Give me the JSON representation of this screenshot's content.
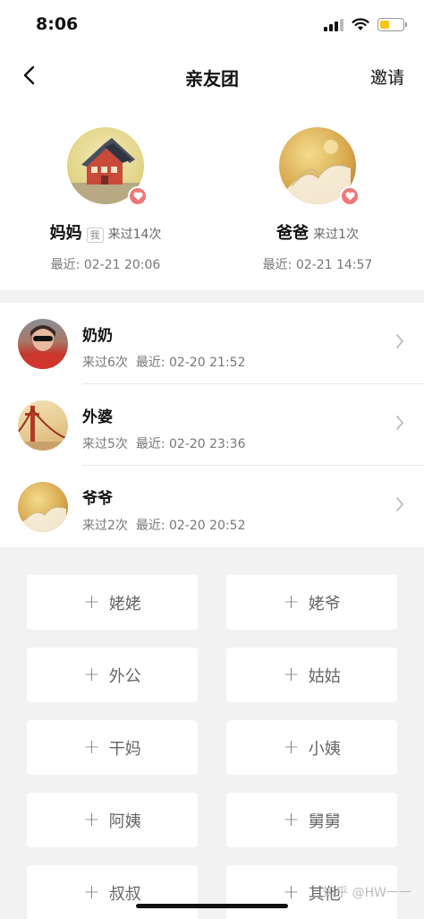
{
  "status": {
    "time": "8:06"
  },
  "nav": {
    "title": "亲友团",
    "invite_label": "邀请"
  },
  "featured": [
    {
      "name": "妈妈",
      "tag": "我",
      "count": "来过14次",
      "recent": "最近: 02-21 20:06",
      "avatar": "house-avatar"
    },
    {
      "name": "爸爸",
      "tag": "",
      "count": "来过1次",
      "recent": "最近: 02-21 14:57",
      "avatar": "book-avatar"
    }
  ],
  "members": [
    {
      "name": "奶奶",
      "count": "来过6次",
      "recent": "最近: 02-20 21:52"
    },
    {
      "name": "外婆",
      "count": "来过5次",
      "recent": "最近: 02-20 23:36"
    },
    {
      "name": "爷爷",
      "count": "来过2次",
      "recent": "最近: 02-20 20:52"
    }
  ],
  "add_buttons": [
    "姥姥",
    "姥爷",
    "外公",
    "姑姑",
    "干妈",
    "小姨",
    "阿姨",
    "舅舅",
    "叔叔",
    "其他"
  ],
  "watermark": "知乎 @HW一一",
  "colors": {
    "badge": "#e77777",
    "battery": "#f5c518"
  }
}
